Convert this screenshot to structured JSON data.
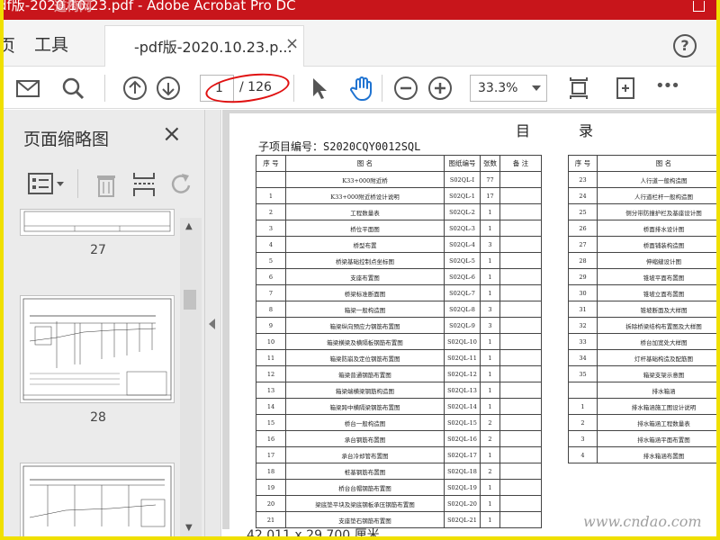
{
  "window": {
    "title": "df版-2020.10.23.pdf - Adobe Acrobat Pro DC",
    "watermark_cn": "道椅网"
  },
  "tabs": {
    "home_partial": "页",
    "tools": "工具",
    "doc_label": "-pdf版-2020.10.23.p...",
    "close_symbol": "×",
    "help_symbol": "?"
  },
  "toolbar": {
    "page_current": "1",
    "page_total": "/ 126",
    "zoom": "33.3%",
    "more_symbol": "•••",
    "icons": [
      "mail-icon",
      "search-icon",
      "previous-page-icon",
      "next-page-icon",
      "select-pointer-icon",
      "hand-tool-icon",
      "zoom-out-icon",
      "zoom-in-icon",
      "fit-page-icon",
      "full-screen-icon",
      "more-icon"
    ],
    "accent_color": "#1f73d1",
    "annotation_color": "#e01010"
  },
  "sidebar": {
    "title": "页面缩略图",
    "close_symbol": "×",
    "icons": [
      "page-options-icon",
      "delete-page-icon",
      "insert-page-icon",
      "rotate-page-icon"
    ],
    "thumbnails": [
      "27",
      "28"
    ]
  },
  "document": {
    "heading_left": "目",
    "heading_right": "录",
    "project_number": "子项目编号：S2020CQY0012SQL",
    "left_table": {
      "headers": [
        "序 号",
        "图 名",
        "图纸编号",
        "张数",
        "备 注"
      ],
      "rows": [
        [
          "",
          "K33+000附近桥",
          "S02QL-I",
          "77",
          ""
        ],
        [
          "1",
          "K33+000附近桥设计说明",
          "S02QL-1",
          "17",
          ""
        ],
        [
          "2",
          "工程数量表",
          "S02QL-2",
          "1",
          ""
        ],
        [
          "3",
          "桥位平面图",
          "S02QL-3",
          "1",
          ""
        ],
        [
          "4",
          "桥型布置",
          "S02QL-4",
          "3",
          ""
        ],
        [
          "5",
          "桥梁基础控制点坐标图",
          "S02QL-5",
          "1",
          ""
        ],
        [
          "6",
          "支座布置图",
          "S02QL-6",
          "1",
          ""
        ],
        [
          "7",
          "桥梁标准断面图",
          "S02QL-7",
          "1",
          ""
        ],
        [
          "8",
          "箱梁一般构造图",
          "S02QL-8",
          "3",
          ""
        ],
        [
          "9",
          "箱梁纵向预应力钢筋布置图",
          "S02QL-9",
          "3",
          ""
        ],
        [
          "10",
          "箱梁横梁及横隔板钢筋布置图",
          "S02QL-10",
          "1",
          ""
        ],
        [
          "11",
          "箱梁防崩及定位钢筋布置图",
          "S02QL-11",
          "1",
          ""
        ],
        [
          "12",
          "箱梁普通钢筋布置图",
          "S02QL-12",
          "1",
          ""
        ],
        [
          "13",
          "箱梁端横梁钢筋构造图",
          "S02QL-13",
          "1",
          ""
        ],
        [
          "14",
          "箱梁跨中横隔梁钢筋布置图",
          "S02QL-14",
          "1",
          ""
        ],
        [
          "15",
          "桥台一般构造图",
          "S02QL-15",
          "2",
          ""
        ],
        [
          "16",
          "承台钢筋布置图",
          "S02QL-16",
          "2",
          ""
        ],
        [
          "17",
          "承台冷却管布置图",
          "S02QL-17",
          "1",
          ""
        ],
        [
          "18",
          "桩基钢筋布置图",
          "S02QL-18",
          "2",
          ""
        ],
        [
          "19",
          "桥台台帽钢筋布置图",
          "S02QL-19",
          "1",
          ""
        ],
        [
          "20",
          "梁底垫平块及梁底钢板承压钢筋布置图",
          "S02QL-20",
          "1",
          ""
        ],
        [
          "21",
          "支座垫石钢筋布置图",
          "S02QL-21",
          "1",
          ""
        ]
      ]
    },
    "right_table": {
      "headers": [
        "序 号",
        "图 名"
      ],
      "rows": [
        [
          "23",
          "人行道一般构造图"
        ],
        [
          "24",
          "人行道栏杆一般构造图"
        ],
        [
          "25",
          "侧分带防撞护栏及基座设计图"
        ],
        [
          "26",
          "桥面排水设计图"
        ],
        [
          "27",
          "桥面铺装构造图"
        ],
        [
          "28",
          "伸缩缝设计图"
        ],
        [
          "29",
          "锥坡平面布置图"
        ],
        [
          "30",
          "锥坡立面布置图"
        ],
        [
          "31",
          "锥坡断面及大样图"
        ],
        [
          "32",
          "拆除桥梁结构布置图及大样图"
        ],
        [
          "33",
          "桥台加宽处大样图"
        ],
        [
          "34",
          "灯杆基础构造及配筋图"
        ],
        [
          "35",
          "箱梁支架示意图"
        ],
        [
          "",
          "排水箱涵"
        ],
        [
          "1",
          "排水箱涵施工图设计说明"
        ],
        [
          "2",
          "排水箱涵工程数量表"
        ],
        [
          "3",
          "排水箱涵平面布置图"
        ],
        [
          "4",
          "排水箱涵布置图"
        ]
      ]
    }
  },
  "status": {
    "dimensions": "42.011 x 29.700 厘米"
  },
  "site_watermark": "www.cndao.com"
}
